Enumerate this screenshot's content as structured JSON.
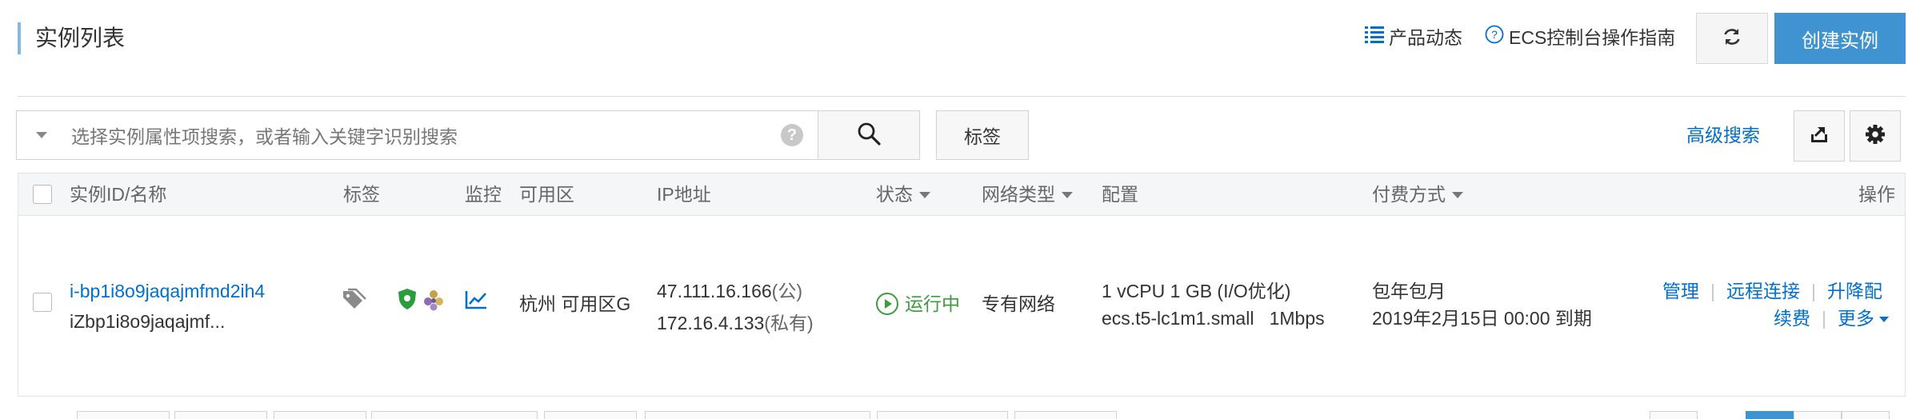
{
  "header": {
    "title": "实例列表",
    "product_news": "产品动态",
    "guide": "ECS控制台操作指南",
    "create_button": "创建实例"
  },
  "search": {
    "placeholder": "选择实例属性项搜索，或者输入关键字识别搜索",
    "help": "?",
    "tag_button": "标签",
    "advanced": "高级搜索"
  },
  "table": {
    "columns": {
      "id_name": "实例ID/名称",
      "tags": "标签",
      "monitor": "监控",
      "zone": "可用区",
      "ip": "IP地址",
      "status": "状态",
      "network": "网络类型",
      "config": "配置",
      "billing": "付费方式",
      "actions": "操作"
    },
    "rows": [
      {
        "instance_id": "i-bp1i8o9jaqajmfmd2ih4",
        "name": "iZbp1i8o9jaqajmf...",
        "zone": "杭州 可用区G",
        "public_ip": "47.111.16.166",
        "public_suffix": "(公)",
        "private_ip": "172.16.4.133",
        "private_suffix": "(私有)",
        "status": "运行中",
        "network": "专有网络",
        "config_line1": "1 vCPU 1 GB (I/O优化)",
        "config_line2": "ecs.t5-lc1m1.small   1Mbps",
        "billing_line1": "包年包月",
        "billing_line2": "2019年2月15日 00:00 到期",
        "actions": {
          "manage": "管理",
          "remote": "远程连接",
          "upgrade": "升降配",
          "renew": "续费",
          "more": "更多"
        }
      }
    ]
  },
  "colors": {
    "accent": "#3f93d1",
    "link": "#0070cc",
    "running": "#3e9b3e"
  }
}
